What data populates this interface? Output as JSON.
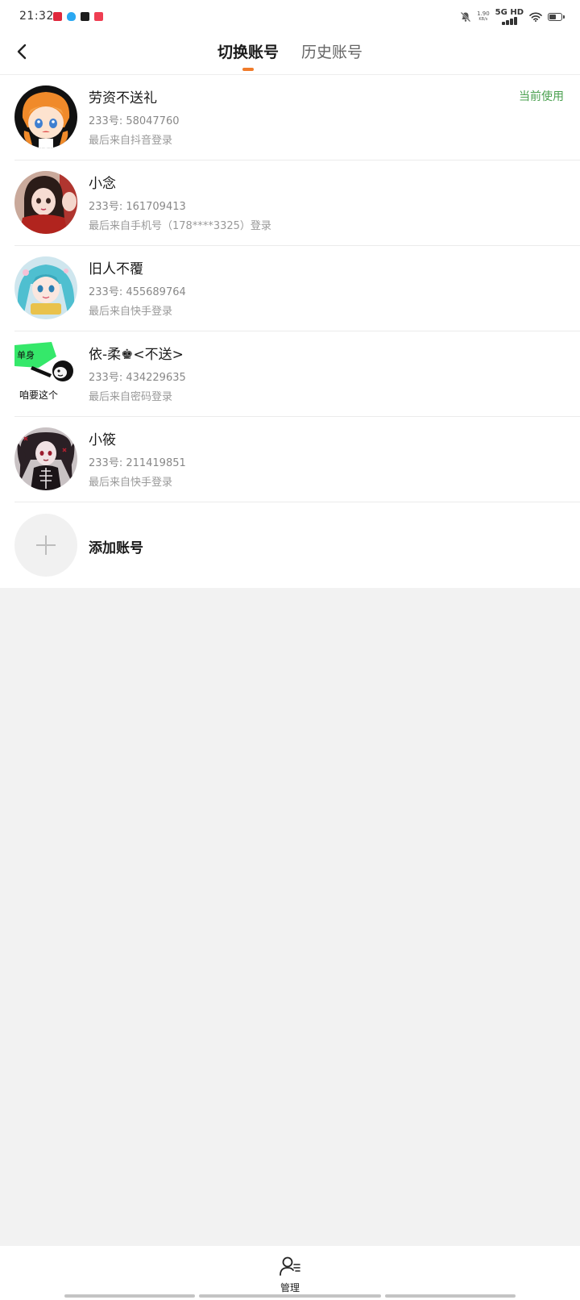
{
  "status_bar": {
    "time": "21:32",
    "net_speed_value": "1.90",
    "net_speed_unit": "KB/s",
    "network_type": "5G HD",
    "app_icon_colors": [
      "#e0283c",
      "#2aa8f2",
      "#1c1c1c",
      "#ef3e52"
    ]
  },
  "header": {
    "tabs": [
      {
        "label": "切换账号",
        "active": true
      },
      {
        "label": "历史账号",
        "active": false
      }
    ],
    "indicator_color": "#f07b2a"
  },
  "accounts": [
    {
      "name": "劳资不送礼",
      "id_text": "233号: 58047760",
      "source_text": "最后来自抖音登录",
      "badge": "当前使用",
      "avatar_icon": "anime-girl-orange-avatar"
    },
    {
      "name": "小念",
      "id_text": "233号: 161709413",
      "source_text": "最后来自手机号（178****3325）登录",
      "avatar_icon": "girl-red-coat-avatar"
    },
    {
      "name": "旧人不覆",
      "id_text": "233号: 455689764",
      "source_text": "最后来自快手登录",
      "avatar_icon": "miku-blue-hair-avatar"
    },
    {
      "name": "依-柔♚<不送>",
      "id_text": "233号: 434229635",
      "source_text": "最后来自密码登录",
      "avatar_icon": "panda-meme-avatar",
      "avatar_text_top": "单身",
      "avatar_text_bottom": "咱要这个"
    },
    {
      "name": "小筱",
      "id_text": "233号: 211419851",
      "source_text": "最后来自快手登录",
      "avatar_icon": "gothic-girl-avatar"
    }
  ],
  "add_account": {
    "label": "添加账号"
  },
  "bottom_bar": {
    "manage_label": "管理"
  }
}
